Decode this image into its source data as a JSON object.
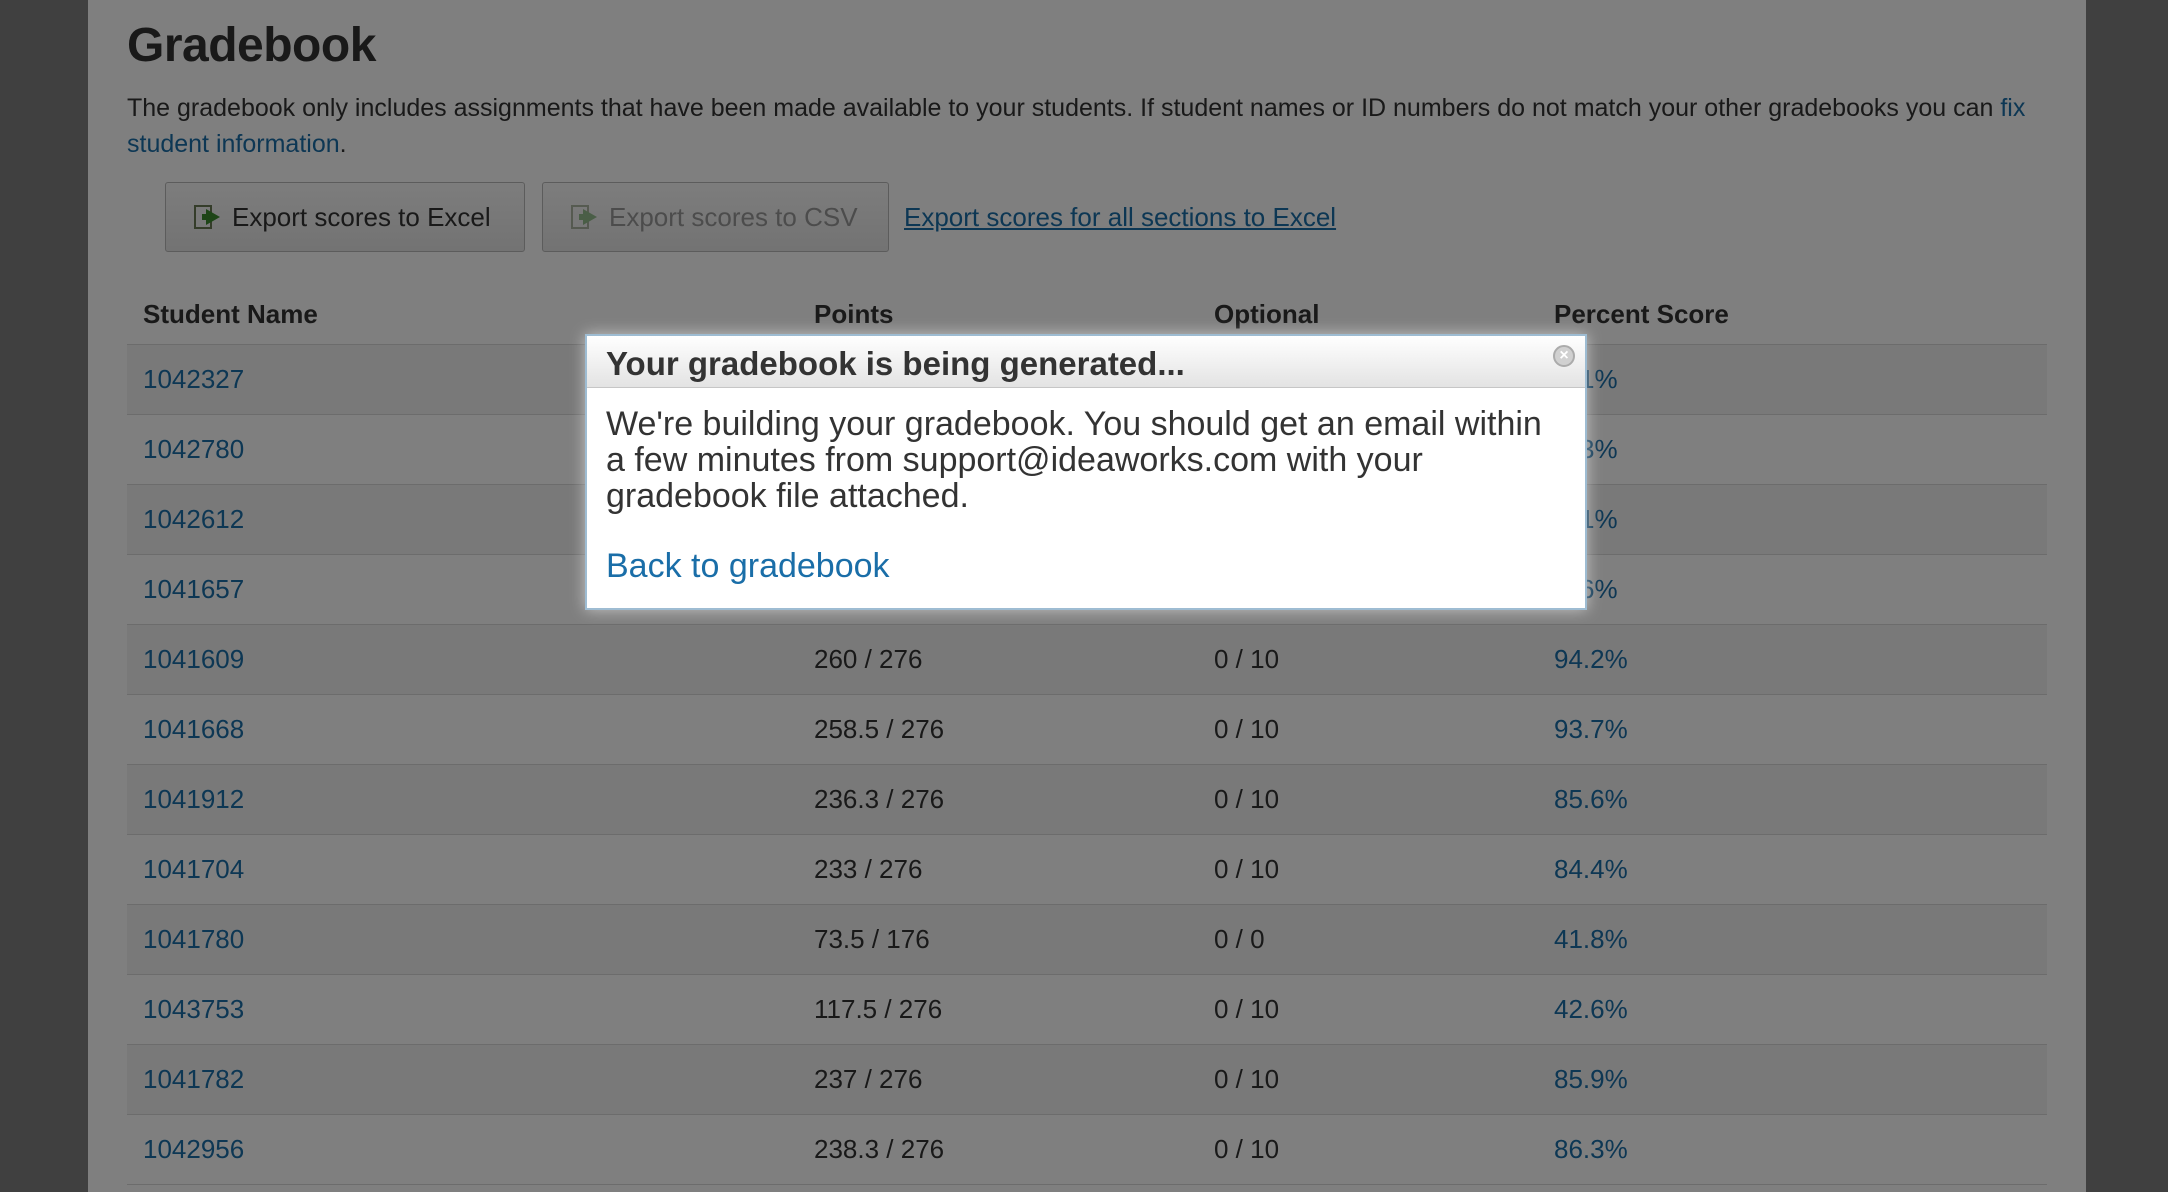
{
  "page": {
    "title": "Gradebook",
    "intro_text": "The gradebook only includes assignments that have been made available to your students. If student names or ID numbers do not match your other gradebooks you can ",
    "intro_link": "fix student information",
    "intro_end": "."
  },
  "toolbar": {
    "excel_label": "Export scores to Excel",
    "csv_label": "Export scores to CSV",
    "all_sections_label": "Export scores for all sections to Excel"
  },
  "table": {
    "headers": [
      "Student Name",
      "Points",
      "Optional",
      "Percent Score"
    ],
    "rows": [
      {
        "name": "1042327",
        "points": "",
        "optional": "",
        "percent": "…1%"
      },
      {
        "name": "1042780",
        "points": "",
        "optional": "",
        "percent": "…3%"
      },
      {
        "name": "1042612",
        "points": "",
        "optional": "",
        "percent": "…1%"
      },
      {
        "name": "1041657",
        "points": "",
        "optional": "",
        "percent": "…6%"
      },
      {
        "name": "1041609",
        "points": "260 / 276",
        "optional": "0 / 10",
        "percent": "94.2%"
      },
      {
        "name": "1041668",
        "points": "258.5 / 276",
        "optional": "0 / 10",
        "percent": "93.7%"
      },
      {
        "name": "1041912",
        "points": "236.3 / 276",
        "optional": "0 / 10",
        "percent": "85.6%"
      },
      {
        "name": "1041704",
        "points": "233 / 276",
        "optional": "0 / 10",
        "percent": "84.4%"
      },
      {
        "name": "1041780",
        "points": "73.5 / 176",
        "optional": "0 / 0",
        "percent": "41.8%"
      },
      {
        "name": "1043753",
        "points": "117.5 / 276",
        "optional": "0 / 10",
        "percent": "42.6%"
      },
      {
        "name": "1041782",
        "points": "237 / 276",
        "optional": "0 / 10",
        "percent": "85.9%"
      },
      {
        "name": "1042956",
        "points": "238.3 / 276",
        "optional": "0 / 10",
        "percent": "86.3%"
      }
    ]
  },
  "modal": {
    "title": "Your gradebook is being generated...",
    "message": "We're building your gradebook. You should get an email within a few minutes from support@ideaworks.com with your gradebook file attached.",
    "back_link": "Back to gradebook",
    "close_glyph": "×"
  }
}
